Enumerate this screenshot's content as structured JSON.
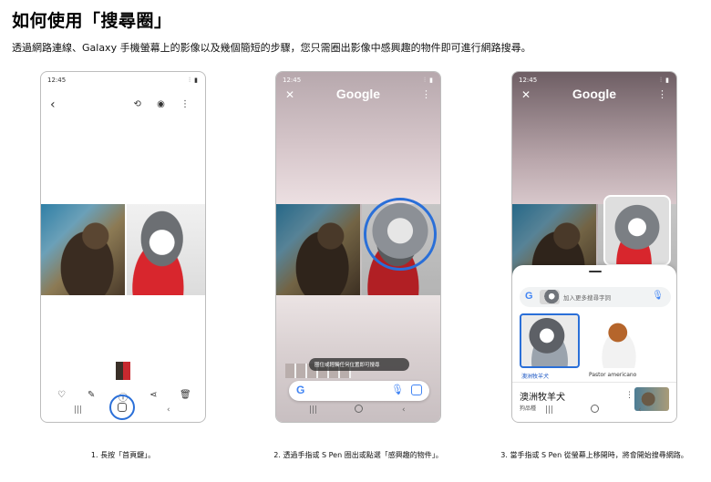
{
  "page": {
    "title": "如何使用「搜尋圈」",
    "description": "透過網路連線、Galaxy 手機螢幕上的影像以及幾個簡短的步驟，您只需圈出影像中感興趣的物件即可進行網路搜尋。"
  },
  "phones": [
    {
      "status_time": "12:45",
      "status_icons": "⫶ ▮",
      "back_icon": "‹",
      "toolbar_icons": "⟲ ◉ ⋮",
      "actions": {
        "favorite": "♡",
        "edit": "✎",
        "info": "ⓘ",
        "share": "⋖",
        "delete": "🗑"
      },
      "nav": {
        "recents": "|||",
        "back": "‹"
      }
    },
    {
      "status_time": "12:45",
      "status_icons": "⫶ ▮",
      "close_icon": "✕",
      "logo": "Google",
      "more_icon": "⋮",
      "hint_text": "圈住或輕觸任何位置即可搜尋",
      "search_g": "G",
      "mic_icon": "🎙",
      "nav": {
        "recents": "|||",
        "back": "‹"
      }
    },
    {
      "status_time": "12:45",
      "status_icons": "⫶ ▮",
      "close_icon": "✕",
      "logo": "Google",
      "more_icon": "⋮",
      "search_g": "G",
      "search_placeholder": "加入更多搜尋字詞",
      "mic_icon": "🎙",
      "results": [
        {
          "label": "澳洲牧羊犬"
        },
        {
          "label": "Pastor americano"
        }
      ],
      "result_title": "澳洲牧羊犬",
      "result_subtitle": "狗品種",
      "result_more": "⋮",
      "nav": {
        "recents": "|||",
        "back": "‹"
      }
    }
  ],
  "captions": [
    "1. 長按「首頁鍵」。",
    "2. 透過手指或 S Pen 圈出或點選「感興趣的物件」。",
    "3. 當手指或 S Pen 從螢幕上移開時，將會開始搜尋網路。"
  ],
  "colors": {
    "accent": "#2a6fd8",
    "google_blue": "#4285f4"
  }
}
